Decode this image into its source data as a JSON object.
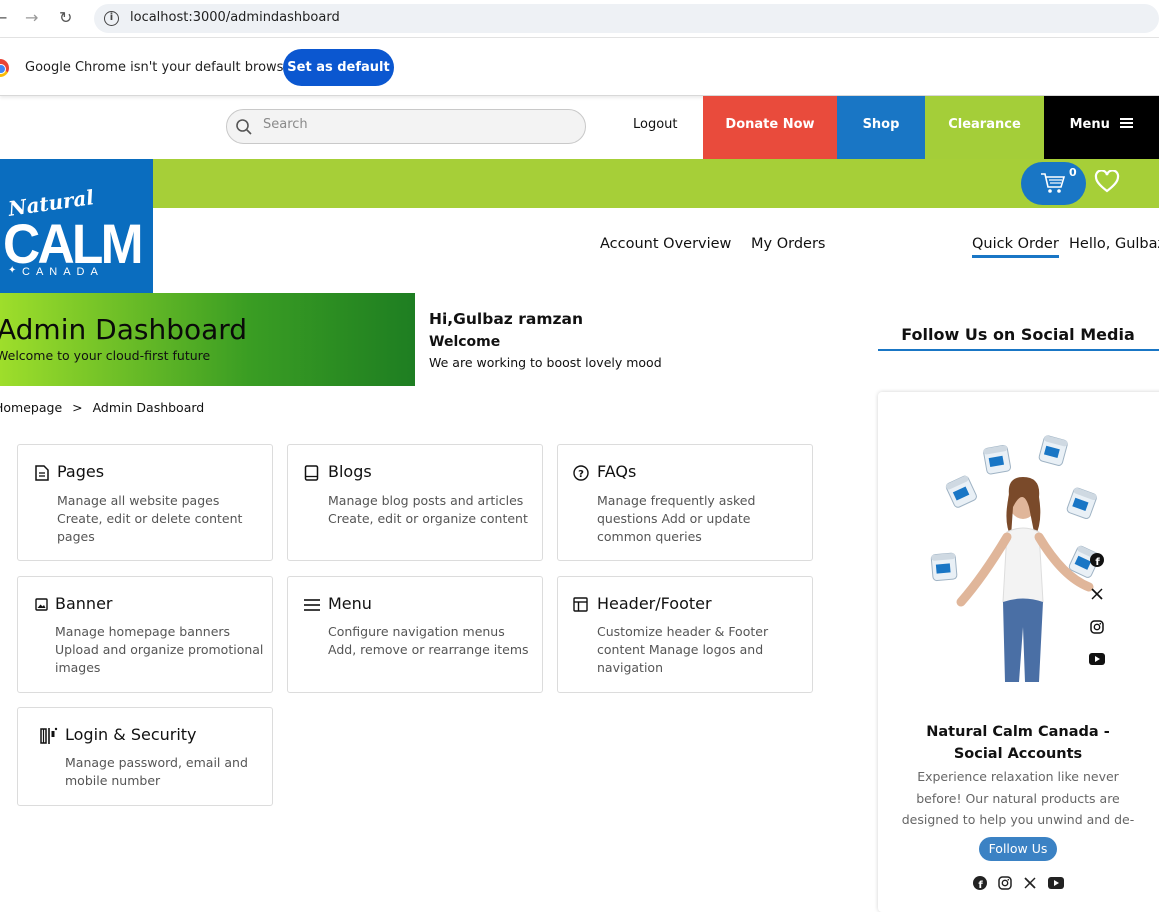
{
  "browser": {
    "url": "localhost:3000/admindashboard",
    "default_message": "Google Chrome isn't your default browser",
    "set_default_label": "Set as default"
  },
  "topnav": {
    "search_placeholder": "Search",
    "logout": "Logout",
    "donate": "Donate Now",
    "shop": "Shop",
    "clearance": "Clearance",
    "menu": "Menu"
  },
  "cart": {
    "count": "0"
  },
  "account_nav": {
    "overview": "Account Overview",
    "orders": "My Orders",
    "quick_order": "Quick Order",
    "hello": "Hello, Gulbaz"
  },
  "logo": {
    "script": "Natural",
    "main": "CALM",
    "country": "CANADA"
  },
  "banner": {
    "title": "Admin Dashboard",
    "subtitle": "Welcome to your cloud-first future"
  },
  "greeting": {
    "hi": "Hi,Gulbaz ramzan",
    "welcome": "Welcome",
    "message": "We are working to boost lovely mood"
  },
  "breadcrumb": {
    "home": "Homepage",
    "sep": ">",
    "current": "Admin Dashboard"
  },
  "cards": [
    {
      "title": "Pages",
      "desc": "Manage all website pages Create, edit or delete content pages",
      "icon": "document-icon"
    },
    {
      "title": "Blogs",
      "desc": "Manage blog posts and articles Create, edit or organize content",
      "icon": "book-icon"
    },
    {
      "title": "FAQs",
      "desc": "Manage frequently asked questions Add or update common queries",
      "icon": "question-icon"
    },
    {
      "title": "Banner",
      "desc": "Manage homepage banners Upload and organize promotional images",
      "icon": "image-icon"
    },
    {
      "title": "Menu",
      "desc": "Configure navigation menus Add, remove or rearrange items",
      "icon": "menu-icon"
    },
    {
      "title": "Header/Footer",
      "desc": "Customize header & Footer content Manage logos and navigation",
      "icon": "layout-icon"
    },
    {
      "title": "Login & Security",
      "desc": "Manage password, email and mobile number",
      "icon": "security-icon"
    }
  ],
  "social": {
    "title": "Follow Us on Social Media",
    "heading": "Natural Calm Canada - Social Accounts",
    "description": "Experience relaxation like never before! Our natural products are designed to help you unwind and de-stress.",
    "button": "Follow Us"
  },
  "colors": {
    "donate": "#e94b3c",
    "shop": "#1976c5",
    "clearance": "#a4ce39",
    "menu": "#000000",
    "brand_green": "#a6cf38",
    "brand_blue": "#0a6dbf"
  }
}
